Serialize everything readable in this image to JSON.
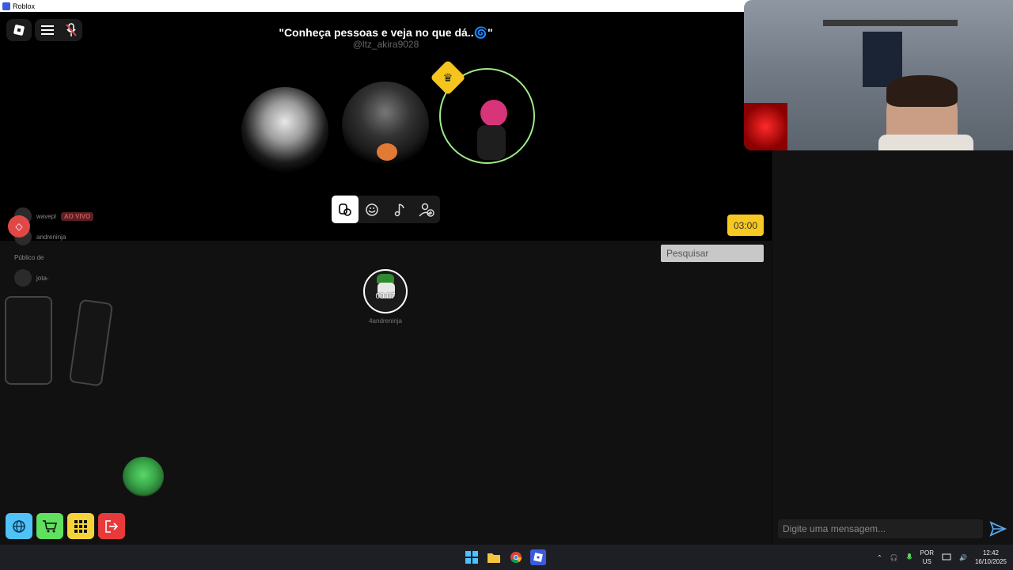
{
  "window": {
    "title": "Roblox"
  },
  "header": {
    "quote": "\"Conheça pessoas e veja no que dá..🌀\"",
    "handle": "@ltz_akira9028"
  },
  "tabs": [
    {
      "name": "voice",
      "icon": "voice-bubble-icon"
    },
    {
      "name": "emotes",
      "icon": "smiley-icon"
    },
    {
      "name": "music",
      "icon": "music-note-icon"
    },
    {
      "name": "add-friend",
      "icon": "add-user-icon"
    }
  ],
  "timer": {
    "value": "03:00"
  },
  "people_list": [
    {
      "name": "wavepl",
      "badge": "AO VIVO"
    },
    {
      "name": "andreninja"
    },
    {
      "name": "Público de"
    },
    {
      "name": "jota-"
    }
  ],
  "search": {
    "placeholder": "Pesquisar"
  },
  "user_bubble": {
    "time": "00:07",
    "name": "4andreninja"
  },
  "bottom_buttons": [
    {
      "name": "globe",
      "color": "#4fc3f7",
      "icon": "globe-icon"
    },
    {
      "name": "shop",
      "color": "#5fe05f",
      "icon": "cart-icon"
    },
    {
      "name": "apps",
      "color": "#f5d23a",
      "icon": "grid-icon"
    },
    {
      "name": "exit",
      "color": "#e83a3a",
      "icon": "exit-icon"
    }
  ],
  "chat": {
    "placeholder": "Digite uma mensagem..."
  },
  "taskbar": {
    "lang_top": "POR",
    "lang_bottom": "US",
    "time": "12:42",
    "date": "16/10/2025"
  },
  "colors": {
    "ring": "#9eea87",
    "crown": "#f5c51d",
    "timer": "#f7c821",
    "send": "#5aa4e8"
  }
}
